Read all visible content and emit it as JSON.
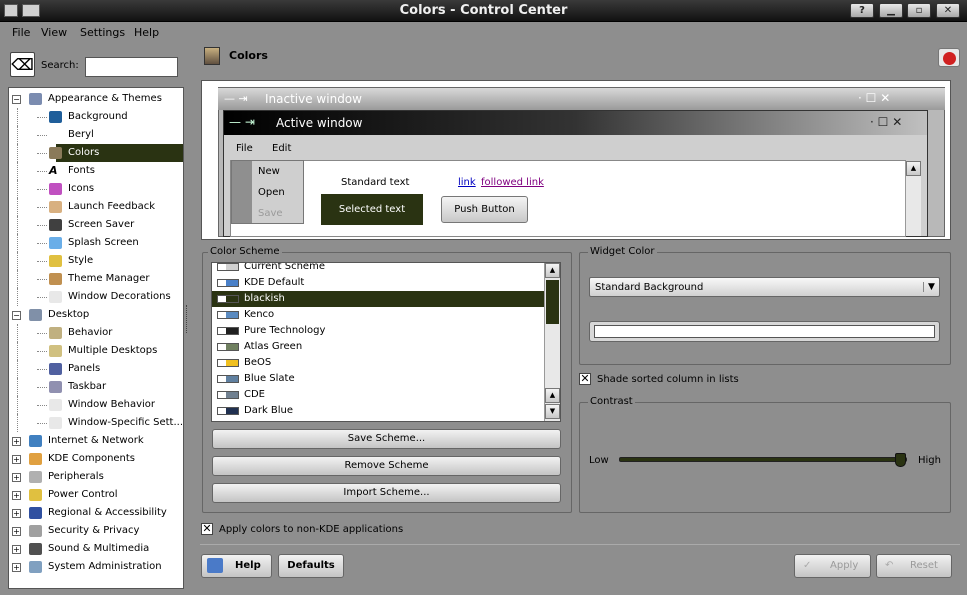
{
  "window": {
    "title": "Colors - Control Center",
    "help_btn": "?"
  },
  "menubar": [
    "File",
    "View",
    "Settings",
    "Help"
  ],
  "search": {
    "label": "Search:",
    "value": ""
  },
  "tree": [
    {
      "label": "Appearance & Themes",
      "level": 0,
      "expander": "−",
      "color": "#7b8cb0"
    },
    {
      "label": "Background",
      "level": 1,
      "color": "#1f5e9a"
    },
    {
      "label": "Beryl",
      "level": 1,
      "color": ""
    },
    {
      "label": "Colors",
      "level": 1,
      "color": "#8a7a5a",
      "selected": true
    },
    {
      "label": "Fonts",
      "level": 1,
      "color": "#444",
      "glyph": "A"
    },
    {
      "label": "Icons",
      "level": 1,
      "color": "#c050c0"
    },
    {
      "label": "Launch Feedback",
      "level": 1,
      "color": "#d8b080"
    },
    {
      "label": "Screen Saver",
      "level": 1,
      "color": "#404040"
    },
    {
      "label": "Splash Screen",
      "level": 1,
      "color": "#6aaee8"
    },
    {
      "label": "Style",
      "level": 1,
      "color": "#e0c040"
    },
    {
      "label": "Theme Manager",
      "level": 1,
      "color": "#c09050"
    },
    {
      "label": "Window Decorations",
      "level": 1,
      "color": "#e8e8e8"
    },
    {
      "label": "Desktop",
      "level": 0,
      "expander": "−",
      "color": "#8090a8"
    },
    {
      "label": "Behavior",
      "level": 1,
      "color": "#c0b080"
    },
    {
      "label": "Multiple Desktops",
      "level": 1,
      "color": "#d0c080"
    },
    {
      "label": "Panels",
      "level": 1,
      "color": "#5060a0"
    },
    {
      "label": "Taskbar",
      "level": 1,
      "color": "#9090b0"
    },
    {
      "label": "Window Behavior",
      "level": 1,
      "color": "#e8e8e8"
    },
    {
      "label": "Window-Specific Sett...",
      "level": 1,
      "color": "#e8e8e8"
    },
    {
      "label": "Internet & Network",
      "level": 0,
      "expander": "+",
      "color": "#4080c0"
    },
    {
      "label": "KDE Components",
      "level": 0,
      "expander": "+",
      "color": "#e0a040"
    },
    {
      "label": "Peripherals",
      "level": 0,
      "expander": "+",
      "color": "#b0b0b0"
    },
    {
      "label": "Power Control",
      "level": 0,
      "expander": "+",
      "color": "#e0c040"
    },
    {
      "label": "Regional & Accessibility",
      "level": 0,
      "expander": "+",
      "color": "#3050a0"
    },
    {
      "label": "Security & Privacy",
      "level": 0,
      "expander": "+",
      "color": "#a0a0a0"
    },
    {
      "label": "Sound & Multimedia",
      "level": 0,
      "expander": "+",
      "color": "#505050"
    },
    {
      "label": "System Administration",
      "level": 0,
      "expander": "+",
      "color": "#80a0c0"
    }
  ],
  "page": {
    "title": "Colors"
  },
  "preview": {
    "inactive_title": "Inactive window",
    "active_title": "Active window",
    "menu": [
      "File",
      "Edit"
    ],
    "popup": [
      "New",
      "Open",
      "Save"
    ],
    "standard_text": "Standard text",
    "selected_text": "Selected text",
    "link": "link",
    "followed_link": "followed link",
    "push_button": "Push Button"
  },
  "color_scheme": {
    "title": "Color Scheme",
    "items": [
      {
        "name": "Current Scheme",
        "swatch": "#d0d0d0"
      },
      {
        "name": "KDE Default",
        "swatch": "#4a80c8"
      },
      {
        "name": "blackish",
        "swatch": "#2a3312",
        "selected": true
      },
      {
        "name": "Kenco",
        "swatch": "#5a8ac0"
      },
      {
        "name": "Pure Technology",
        "swatch": "#202020"
      },
      {
        "name": "Atlas Green",
        "swatch": "#708060"
      },
      {
        "name": "BeOS",
        "swatch": "#f0c020"
      },
      {
        "name": "Blue Slate",
        "swatch": "#6080a0"
      },
      {
        "name": "CDE",
        "swatch": "#708090"
      },
      {
        "name": "Dark Blue",
        "swatch": "#203050"
      }
    ],
    "save": "Save Scheme...",
    "remove": "Remove Scheme",
    "import": "Import Scheme..."
  },
  "widget_color": {
    "title": "Widget Color",
    "selected": "Standard Background",
    "swatch": "#ffffff"
  },
  "shade_sorted": {
    "label": "Shade sorted column in lists",
    "checked": true
  },
  "contrast": {
    "title": "Contrast",
    "low": "Low",
    "high": "High",
    "level": 1.0
  },
  "apply_non_kde": {
    "label": "Apply colors to non-KDE applications",
    "checked": true
  },
  "buttons": {
    "help": "Help",
    "defaults": "Defaults",
    "apply": "Apply",
    "reset": "Reset"
  },
  "colors": {
    "selection": "#2a3312",
    "window_bg": "#8e8e8e"
  }
}
